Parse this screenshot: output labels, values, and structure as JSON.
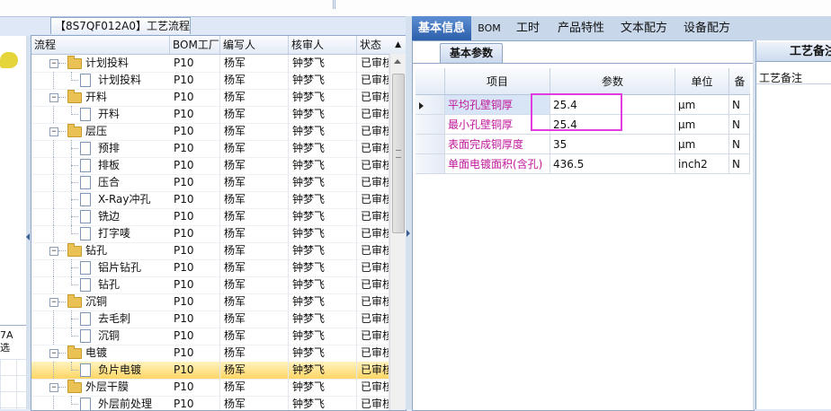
{
  "tree_panel": {
    "title": "【8S7QF012A0】工艺流程",
    "columns": [
      "流程",
      "BOM工厂",
      "编写人",
      "核审人",
      "状态"
    ],
    "rows": [
      {
        "label": "计划投料",
        "type": "folder",
        "level": 1,
        "plant": "P10",
        "writer": "杨军",
        "reviewer": "钟梦飞",
        "status": "已审核"
      },
      {
        "label": "计划投料",
        "type": "doc",
        "level": 2,
        "plant": "P10",
        "writer": "杨军",
        "reviewer": "钟梦飞",
        "status": "已审核"
      },
      {
        "label": "开料",
        "type": "folder",
        "level": 1,
        "plant": "P10",
        "writer": "杨军",
        "reviewer": "钟梦飞",
        "status": "已审核"
      },
      {
        "label": "开料",
        "type": "doc",
        "level": 2,
        "plant": "P10",
        "writer": "杨军",
        "reviewer": "钟梦飞",
        "status": "已审核"
      },
      {
        "label": "层压",
        "type": "folder",
        "level": 1,
        "plant": "P10",
        "writer": "杨军",
        "reviewer": "钟梦飞",
        "status": "已审核"
      },
      {
        "label": "预排",
        "type": "doc",
        "level": 2,
        "plant": "P10",
        "writer": "杨军",
        "reviewer": "钟梦飞",
        "status": "已审核"
      },
      {
        "label": "排板",
        "type": "doc",
        "level": 2,
        "plant": "P10",
        "writer": "杨军",
        "reviewer": "钟梦飞",
        "status": "已审核"
      },
      {
        "label": "压合",
        "type": "doc",
        "level": 2,
        "plant": "P10",
        "writer": "杨军",
        "reviewer": "钟梦飞",
        "status": "已审核"
      },
      {
        "label": "X-Ray冲孔",
        "type": "doc",
        "level": 2,
        "plant": "P10",
        "writer": "杨军",
        "reviewer": "钟梦飞",
        "status": "已审核"
      },
      {
        "label": "铣边",
        "type": "doc",
        "level": 2,
        "plant": "P10",
        "writer": "杨军",
        "reviewer": "钟梦飞",
        "status": "已审核"
      },
      {
        "label": "打字唛",
        "type": "doc",
        "level": 2,
        "plant": "P10",
        "writer": "杨军",
        "reviewer": "钟梦飞",
        "status": "已审核"
      },
      {
        "label": "钻孔",
        "type": "folder",
        "level": 1,
        "plant": "P10",
        "writer": "杨军",
        "reviewer": "钟梦飞",
        "status": "已审核"
      },
      {
        "label": "铝片钻孔",
        "type": "doc",
        "level": 2,
        "plant": "P10",
        "writer": "杨军",
        "reviewer": "钟梦飞",
        "status": "已审核"
      },
      {
        "label": "钻孔",
        "type": "doc",
        "level": 2,
        "plant": "P10",
        "writer": "杨军",
        "reviewer": "钟梦飞",
        "status": "已审核"
      },
      {
        "label": "沉铜",
        "type": "folder",
        "level": 1,
        "plant": "P10",
        "writer": "杨军",
        "reviewer": "钟梦飞",
        "status": "已审核"
      },
      {
        "label": "去毛刺",
        "type": "doc",
        "level": 2,
        "plant": "P10",
        "writer": "杨军",
        "reviewer": "钟梦飞",
        "status": "已审核"
      },
      {
        "label": "沉铜",
        "type": "doc",
        "level": 2,
        "plant": "P10",
        "writer": "杨军",
        "reviewer": "钟梦飞",
        "status": "已审核"
      },
      {
        "label": "电镀",
        "type": "folder",
        "level": 1,
        "plant": "P10",
        "writer": "杨军",
        "reviewer": "钟梦飞",
        "status": "已审核"
      },
      {
        "label": "负片电镀",
        "type": "doc",
        "level": 2,
        "plant": "P10",
        "writer": "杨军",
        "reviewer": "钟梦飞",
        "status": "已审核",
        "selected": true
      },
      {
        "label": "外层干膜",
        "type": "folder",
        "level": 1,
        "plant": "P10",
        "writer": "杨军",
        "reviewer": "钟梦飞",
        "status": "已审核"
      },
      {
        "label": "外层前处理",
        "type": "doc",
        "level": 2,
        "plant": "P10",
        "writer": "杨军",
        "reviewer": "钟梦飞",
        "status": "已审核"
      }
    ]
  },
  "left_pane": {
    "tag_line1": "7A",
    "tag_line2": "选"
  },
  "tabs": [
    "基本信息",
    "BOM",
    "工时",
    "产品特性",
    "文本配方",
    "设备配方"
  ],
  "active_tab": "基本信息",
  "basic_params": {
    "subtab": "基本参数",
    "columns": [
      "项目",
      "参数",
      "单位",
      "备"
    ],
    "rows": [
      {
        "item": "平均孔壁铜厚",
        "value": "25.4",
        "unit": "μm",
        "flag": "N"
      },
      {
        "item": "最小孔壁铜厚",
        "value": "25.4",
        "unit": "μm",
        "flag": "N"
      },
      {
        "item": "表面完成铜厚度",
        "value": "35",
        "unit": "μm",
        "flag": "N"
      },
      {
        "item": "单面电镀面积(含孔)",
        "value": "436.5",
        "unit": "inch2",
        "flag": "N"
      }
    ]
  },
  "remarks_panel": {
    "title": "工艺备注",
    "label": "工艺备注"
  },
  "colors": {
    "selection": "#ffd665",
    "active_tab": "#2c5fab",
    "item_text": "#c0189a",
    "highlight_box": "#e23be0"
  }
}
